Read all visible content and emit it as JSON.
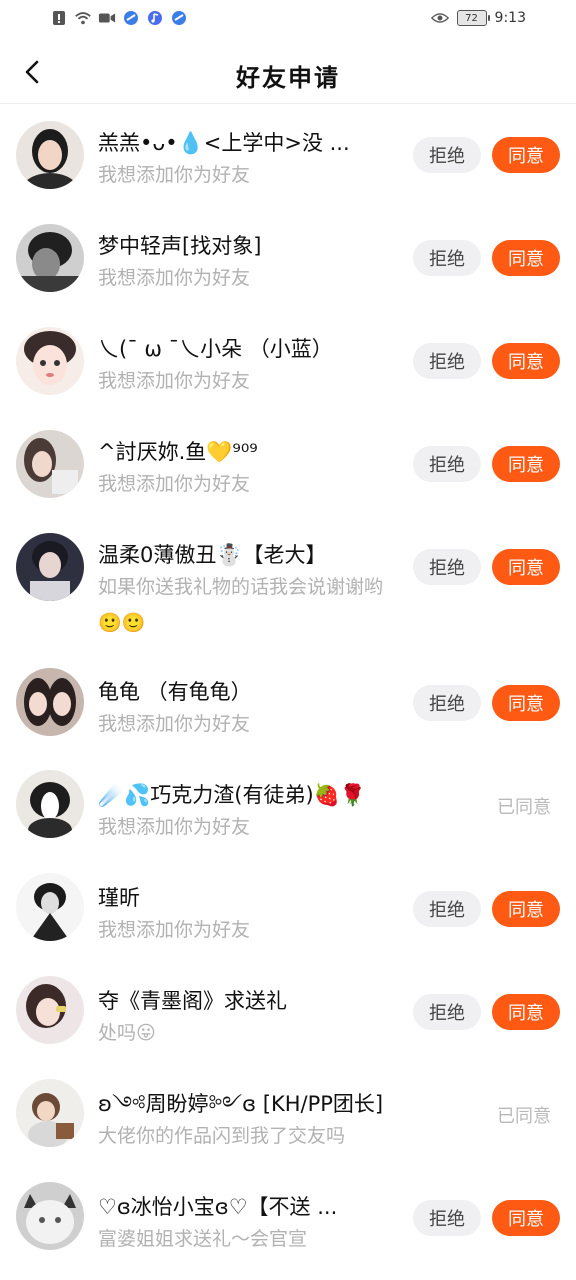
{
  "status_bar": {
    "icons_left": [
      "alert-icon",
      "wifi-icon",
      "camera-icon",
      "app-icon",
      "music-icon",
      "app-icon"
    ],
    "battery": "72",
    "time": "9:13"
  },
  "nav": {
    "title": "好友申请"
  },
  "colors": {
    "accent": "#ff5a14",
    "reject_bg": "#f0f0f3",
    "muted_text": "#b2b2b2"
  },
  "buttons": {
    "reject": "拒绝",
    "accept": "同意",
    "accepted": "已同意"
  },
  "requests": [
    {
      "name": "羔羔•ᴗ•💧<上学中>没 ...",
      "message": "我想添加你为好友",
      "status": "pending"
    },
    {
      "name": "梦中轻声[找对象]",
      "message": "我想添加你为好友",
      "status": "pending"
    },
    {
      "name": "乀(ˉ ω ˉ乀小朵 （小蓝）",
      "message": "我想添加你为好友",
      "status": "pending"
    },
    {
      "name": "^討厌妳.鱼💛⁹⁰⁹",
      "message": "我想添加你为好友",
      "status": "pending"
    },
    {
      "name": "温柔0薄傲丑☃️【老大】",
      "message": "如果你送我礼物的话我会说谢谢哟🙂🙂",
      "status": "pending"
    },
    {
      "name": "龟龟 （有龟龟）",
      "message": "我想添加你为好友",
      "status": "pending"
    },
    {
      "name": "☄️💦巧克力渣(有徒弟)🍓🌹",
      "message": "我想添加你为好友",
      "status": "accepted"
    },
    {
      "name": "瑾昕",
      "message": "我想添加你为好友",
      "status": "pending"
    },
    {
      "name": "夺《青墨阁》求送礼",
      "message": "处吗😛",
      "status": "pending"
    },
    {
      "name": "ʚ༺周盼婷༻ɞ [KH/PP团长]",
      "message": "大佬你的作品闪到我了交友吗",
      "status": "accepted"
    },
    {
      "name": "♡ɞ冰怡小宝ɞ♡【不送 ...",
      "message": "富婆姐姐求送礼～会官宣",
      "status": "pending"
    }
  ]
}
